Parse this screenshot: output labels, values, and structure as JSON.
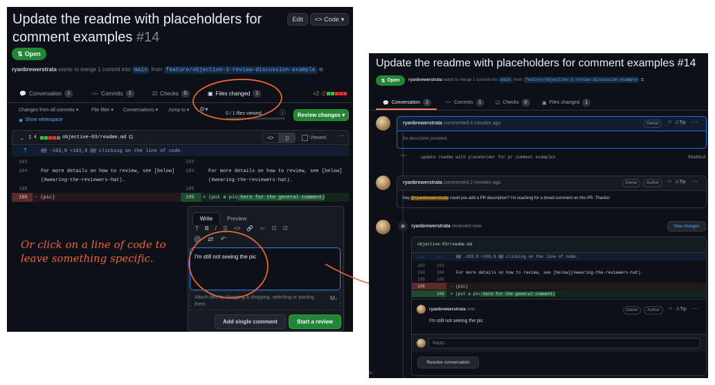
{
  "left": {
    "title": "Update the readme with placeholders for comment examples",
    "pr_number": "#14",
    "edit_label": "Edit",
    "code_label": "Code",
    "status": "Open",
    "author": "ryanbrewerstrata",
    "merge_text": "wants to merge 1 commit into",
    "base_branch": "main",
    "from_text": "from",
    "head_branch": "feature/objective-3-review-discussion-example",
    "tabs": [
      {
        "label": "Conversation",
        "count": "1"
      },
      {
        "label": "Commits",
        "count": "1"
      },
      {
        "label": "Checks",
        "count": "0"
      },
      {
        "label": "Files changed",
        "count": "1"
      }
    ],
    "diffstat": {
      "added": "+2",
      "removed": "-2"
    },
    "toolbar": {
      "changes_from": "Changes from all commits",
      "file_filter": "File filter",
      "conversations": "Conversations",
      "jump_to": "Jump to",
      "files_viewed": "0 / 1 files viewed",
      "review_changes": "Review changes",
      "show_whitespace": "Show whitespace"
    },
    "file": {
      "changes_count": "4",
      "path": "objective-03/readme.md",
      "viewed": "Viewed"
    },
    "hunk": "@@ -103,9 +103,9 @@ clicking on the line of code.",
    "lines": {
      "l103": "103",
      "r103": "103",
      "l104": "104",
      "r104": "104",
      "text104a": "For more details on how to review, see [below]",
      "text104b": "(#wearing-the-reviewers-hat).",
      "l105": "105",
      "r105": "105",
      "l106": "106",
      "r106": "106",
      "removed_text": "- (pic)",
      "added_prefix": "+ (put a pic",
      "added_highlight": " here for the general comment)"
    },
    "editor": {
      "write_tab": "Write",
      "preview_tab": "Preview",
      "textarea_value": "I'm still not seeing the pic",
      "attach_hint": "Attach files by dragging & dropping, selecting or pasting them.",
      "add_single": "Add single comment",
      "start_review": "Start a review"
    },
    "annotation": "Or click on a line of code to leave something specific."
  },
  "right": {
    "title": "Update the readme with placeholders for comment examples #14",
    "status": "Open",
    "author": "ryanbrewerstrata",
    "merge_text": "wants to merge 1 commit into",
    "base_branch": "main",
    "from_text": "from",
    "head_branch": "feature/objective-3-review-discussion-example",
    "tabs": [
      {
        "label": "Conversation",
        "count": "2"
      },
      {
        "label": "Commits",
        "count": "1"
      },
      {
        "label": "Checks",
        "count": "0"
      },
      {
        "label": "Files changed",
        "count": "1"
      }
    ],
    "comment1": {
      "author": "ryanbrewerstrata",
      "meta": "commented 4 minutes ago",
      "role": "Owner",
      "body": "No description provided."
    },
    "commit": {
      "message": "update readme with placeholder for pr comment examples",
      "sha": "59a6Gcd"
    },
    "comment2": {
      "author": "ryanbrewerstrata",
      "meta": "commented 2 minutes ago",
      "role_owner": "Owner",
      "role_author": "Author",
      "body_prefix": "hey",
      "mention": "@ryanbrewerstrata",
      "body_suffix": "could you add a PR description? I'm reaching for a broad comment on this PR. Thanks!"
    },
    "review": {
      "author": "ryanbrewerstrata",
      "meta": "reviewed now",
      "view_changes": "View changes",
      "file_path": "objective-03/readme.md",
      "ellipsis_left": "...",
      "ellipsis_right": "...",
      "hunk": "@@ -103,9 +103,9 @@ clicking on the line of code.",
      "l103": "103",
      "r103": "103",
      "l104": "104",
      "r104": "104",
      "line104": "For more details on how to review, see [below](#wearing-the-reviewers-hat).",
      "l105": "105",
      "r105": "105",
      "l106": "106",
      "r106": "106",
      "removed_text": "- (pic)",
      "added_prefix": "+ (put a pic",
      "added_highlight": " here for the general comment)"
    },
    "inline_comment": {
      "author": "ryanbrewerstrata",
      "meta": "now",
      "role_owner": "Owner",
      "role_author": "Author",
      "body": "I'm still not seeing the pic"
    },
    "reply_placeholder": "Reply...",
    "resolve_label": "Resolve conversation",
    "footer_text": "ts"
  },
  "colors": {
    "bg": "#0d1117",
    "accent_green": "#238636",
    "link_blue": "#2f81f7",
    "annotation_orange": "#e8663a",
    "diff_added": "#12261e",
    "diff_removed": "#25171c"
  }
}
